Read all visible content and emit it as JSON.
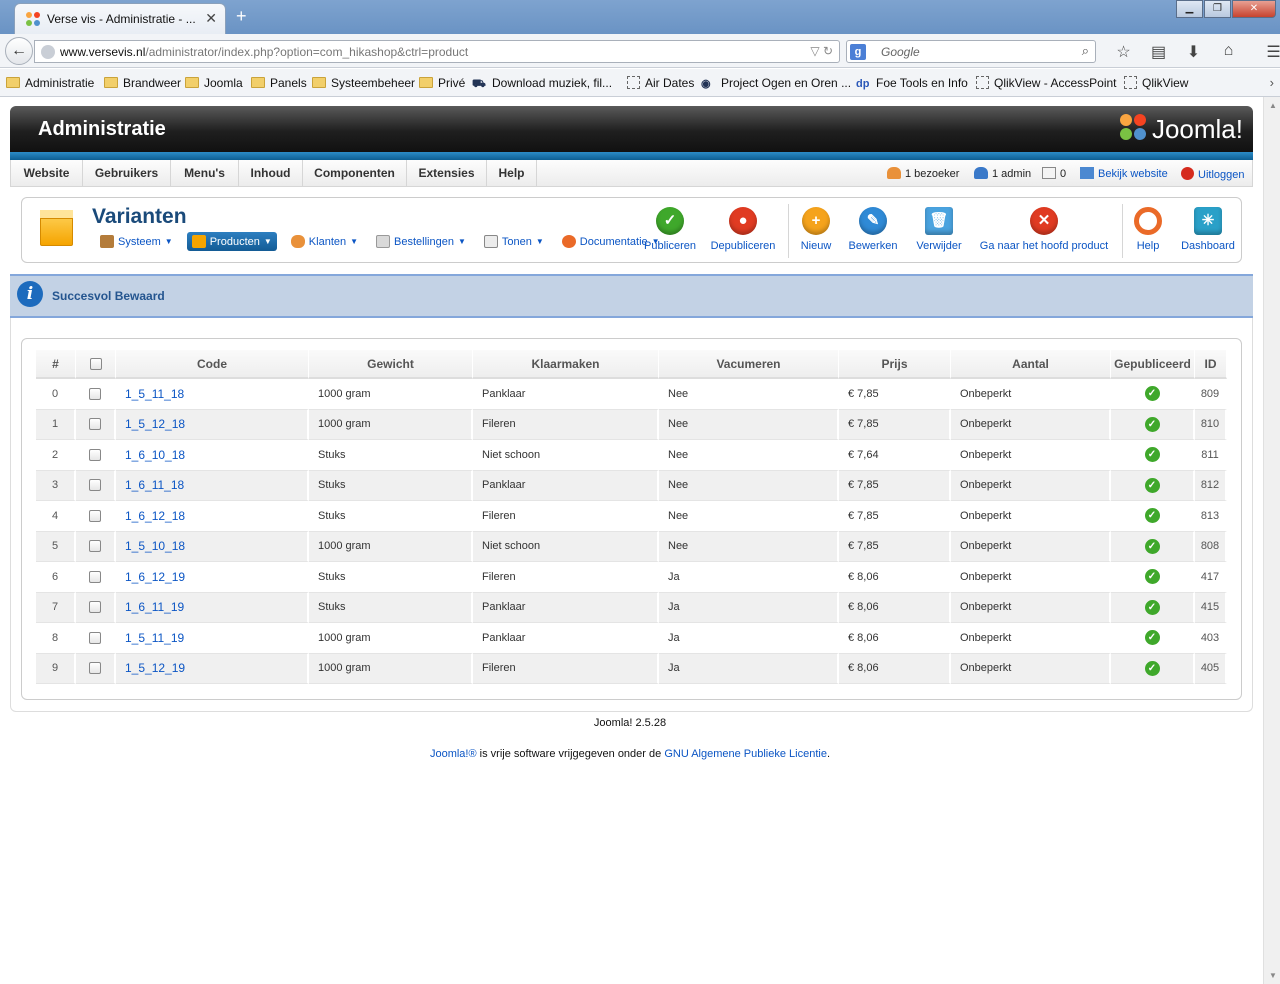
{
  "browser": {
    "tab_title": "Verse vis - Administratie - ...",
    "url_host": "www.versevis.nl",
    "url_path": "/administrator/index.php?option=com_hikashop&ctrl=product",
    "search_placeholder": "Google",
    "bookmarks": [
      {
        "label": "Administratie",
        "icon": "folder-icon"
      },
      {
        "label": "Brandweer",
        "icon": "folder-icon"
      },
      {
        "label": "Joomla",
        "icon": "folder-icon"
      },
      {
        "label": "Panels",
        "icon": "folder-icon"
      },
      {
        "label": "Systeembeheer",
        "icon": "folder-icon"
      },
      {
        "label": "Privé",
        "icon": "folder-icon"
      },
      {
        "label": "Download muziek, fil...",
        "icon": "download-icon"
      },
      {
        "label": "Air Dates",
        "icon": "page-icon"
      },
      {
        "label": "Project Ogen en Oren ...",
        "icon": "eye-icon"
      },
      {
        "label": "Foe Tools en Info",
        "icon": "dp-icon"
      },
      {
        "label": "QlikView - AccessPoint",
        "icon": "page-icon"
      },
      {
        "label": "QlikView",
        "icon": "page-icon"
      }
    ]
  },
  "header": {
    "title": "Administratie",
    "logo_text": "Joomla!"
  },
  "menu": {
    "items": [
      "Website",
      "Gebruikers",
      "Menu's",
      "Inhoud",
      "Componenten",
      "Extensies",
      "Help"
    ],
    "status": {
      "visitors": "1 bezoeker",
      "admins": "1 admin",
      "messages": "0",
      "view_site": "Bekijk website",
      "logout": "Uitloggen"
    }
  },
  "page": {
    "title": "Varianten",
    "submenu": [
      {
        "label": "Systeem",
        "active": false
      },
      {
        "label": "Producten",
        "active": true
      },
      {
        "label": "Klanten",
        "active": false
      },
      {
        "label": "Bestellingen",
        "active": false
      },
      {
        "label": "Tonen",
        "active": false
      },
      {
        "label": "Documentatie",
        "active": false
      }
    ],
    "toolbar": {
      "publish": "Publiceren",
      "unpublish": "Depubliceren",
      "new": "Nieuw",
      "edit": "Bewerken",
      "delete": "Verwijder",
      "goto_main": "Ga naar het hoofd product",
      "help": "Help",
      "dashboard": "Dashboard"
    },
    "message": "Succesvol Bewaard"
  },
  "table": {
    "columns": [
      "#",
      "",
      "Code",
      "Gewicht",
      "Klaarmaken",
      "Vacumeren",
      "Prijs",
      "Aantal",
      "Gepubliceerd",
      "ID"
    ],
    "rows": [
      {
        "idx": "0",
        "code": "1_5_11_18",
        "gewicht": "1000 gram",
        "klaarmaken": "Panklaar",
        "vacumeren": "Nee",
        "prijs": "€ 7,85",
        "aantal": "Onbeperkt",
        "id": "809"
      },
      {
        "idx": "1",
        "code": "1_5_12_18",
        "gewicht": "1000 gram",
        "klaarmaken": "Fileren",
        "vacumeren": "Nee",
        "prijs": "€ 7,85",
        "aantal": "Onbeperkt",
        "id": "810"
      },
      {
        "idx": "2",
        "code": "1_6_10_18",
        "gewicht": "Stuks",
        "klaarmaken": "Niet schoon",
        "vacumeren": "Nee",
        "prijs": "€ 7,64",
        "aantal": "Onbeperkt",
        "id": "811"
      },
      {
        "idx": "3",
        "code": "1_6_11_18",
        "gewicht": "Stuks",
        "klaarmaken": "Panklaar",
        "vacumeren": "Nee",
        "prijs": "€ 7,85",
        "aantal": "Onbeperkt",
        "id": "812"
      },
      {
        "idx": "4",
        "code": "1_6_12_18",
        "gewicht": "Stuks",
        "klaarmaken": "Fileren",
        "vacumeren": "Nee",
        "prijs": "€ 7,85",
        "aantal": "Onbeperkt",
        "id": "813"
      },
      {
        "idx": "5",
        "code": "1_5_10_18",
        "gewicht": "1000 gram",
        "klaarmaken": "Niet schoon",
        "vacumeren": "Nee",
        "prijs": "€ 7,85",
        "aantal": "Onbeperkt",
        "id": "808"
      },
      {
        "idx": "6",
        "code": "1_6_12_19",
        "gewicht": "Stuks",
        "klaarmaken": "Fileren",
        "vacumeren": "Ja",
        "prijs": "€ 8,06",
        "aantal": "Onbeperkt",
        "id": "417"
      },
      {
        "idx": "7",
        "code": "1_6_11_19",
        "gewicht": "Stuks",
        "klaarmaken": "Panklaar",
        "vacumeren": "Ja",
        "prijs": "€ 8,06",
        "aantal": "Onbeperkt",
        "id": "415"
      },
      {
        "idx": "8",
        "code": "1_5_11_19",
        "gewicht": "1000 gram",
        "klaarmaken": "Panklaar",
        "vacumeren": "Ja",
        "prijs": "€ 8,06",
        "aantal": "Onbeperkt",
        "id": "403"
      },
      {
        "idx": "9",
        "code": "1_5_12_19",
        "gewicht": "1000 gram",
        "klaarmaken": "Fileren",
        "vacumeren": "Ja",
        "prijs": "€ 8,06",
        "aantal": "Onbeperkt",
        "id": "405"
      }
    ]
  },
  "footer": {
    "version": "Joomla! 2.5.28",
    "license_link1": "Joomla!®",
    "license_text": " is vrije software vrijgegeven onder de ",
    "license_link2": "GNU Algemene Publieke Licentie",
    "license_end": "."
  },
  "colors": {
    "link": "#0b55c4",
    "header_dark": "#1f1f1f",
    "accent_blue": "#0d5f93",
    "message_bg": "#c3d2e5",
    "published_green": "#3fa82b"
  }
}
